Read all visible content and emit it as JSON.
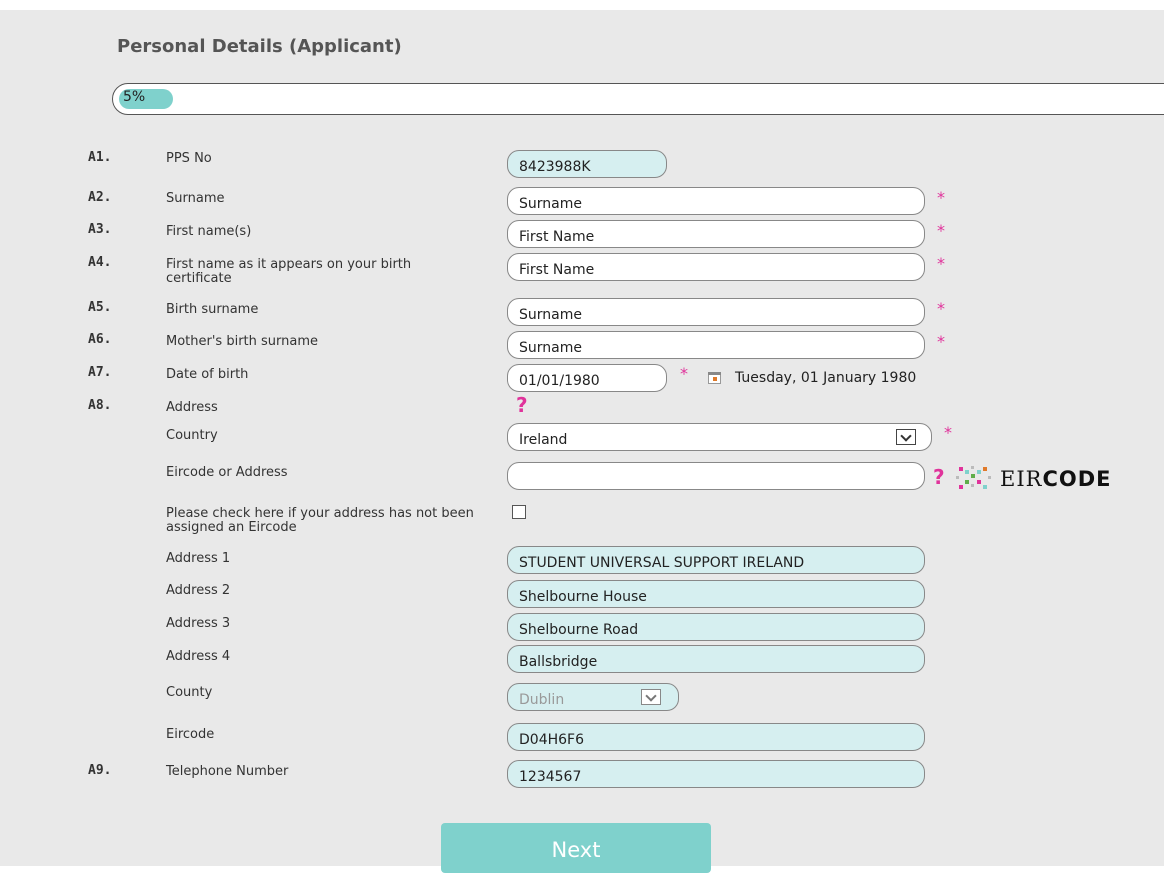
{
  "page": {
    "title": "Personal Details (Applicant)",
    "progress_value": 0.05,
    "progress_label": "5%"
  },
  "fields": {
    "a1": {
      "num": "A1.",
      "label": "PPS No",
      "value": "8423988K"
    },
    "a2": {
      "num": "A2.",
      "label": "Surname",
      "value": "Surname"
    },
    "a3": {
      "num": "A3.",
      "label": "First name(s)",
      "value": "First Name"
    },
    "a4": {
      "num": "A4.",
      "label": "First name as it appears on your birth certificate",
      "value": "First Name"
    },
    "a5": {
      "num": "A5.",
      "label": "Birth surname",
      "value": "Surname"
    },
    "a6": {
      "num": "A6.",
      "label": "Mother's birth surname",
      "value": "Surname"
    },
    "a7": {
      "num": "A7.",
      "label": "Date of birth",
      "value": "01/01/1980",
      "display": "Tuesday, 01 January 1980"
    },
    "a8": {
      "num": "A8.",
      "label": "Address"
    },
    "country": {
      "label": "Country",
      "value": "Ireland"
    },
    "eircode_lookup": {
      "label": "Eircode or Address",
      "value": ""
    },
    "no_eircode": {
      "label": "Please check here if your address has not been assigned an Eircode"
    },
    "address1": {
      "label": "Address 1",
      "value": "STUDENT UNIVERSAL SUPPORT IRELAND"
    },
    "address2": {
      "label": "Address 2",
      "value": "Shelbourne House"
    },
    "address3": {
      "label": "Address 3",
      "value": "Shelbourne Road"
    },
    "address4": {
      "label": "Address 4",
      "value": "Ballsbridge"
    },
    "county": {
      "label": "County",
      "value": "Dublin"
    },
    "eircode": {
      "label": "Eircode",
      "value": "D04H6F6"
    },
    "a9": {
      "num": "A9.",
      "label": "Telephone Number",
      "value": "1234567"
    }
  },
  "required_mark": "*",
  "help_mark": "?",
  "eircode_brand": {
    "prefix": "EIR",
    "suffix": "CODE"
  },
  "buttons": {
    "next": "Next"
  },
  "colors": {
    "accent": "#7fd1cc",
    "required": "#e0339b",
    "readonly_bg": "#d6eff0",
    "panel_bg": "#e9e9e9"
  },
  "icons": [
    "calendar-icon",
    "help-icon",
    "eircode-logo",
    "chevron-down-icon"
  ]
}
